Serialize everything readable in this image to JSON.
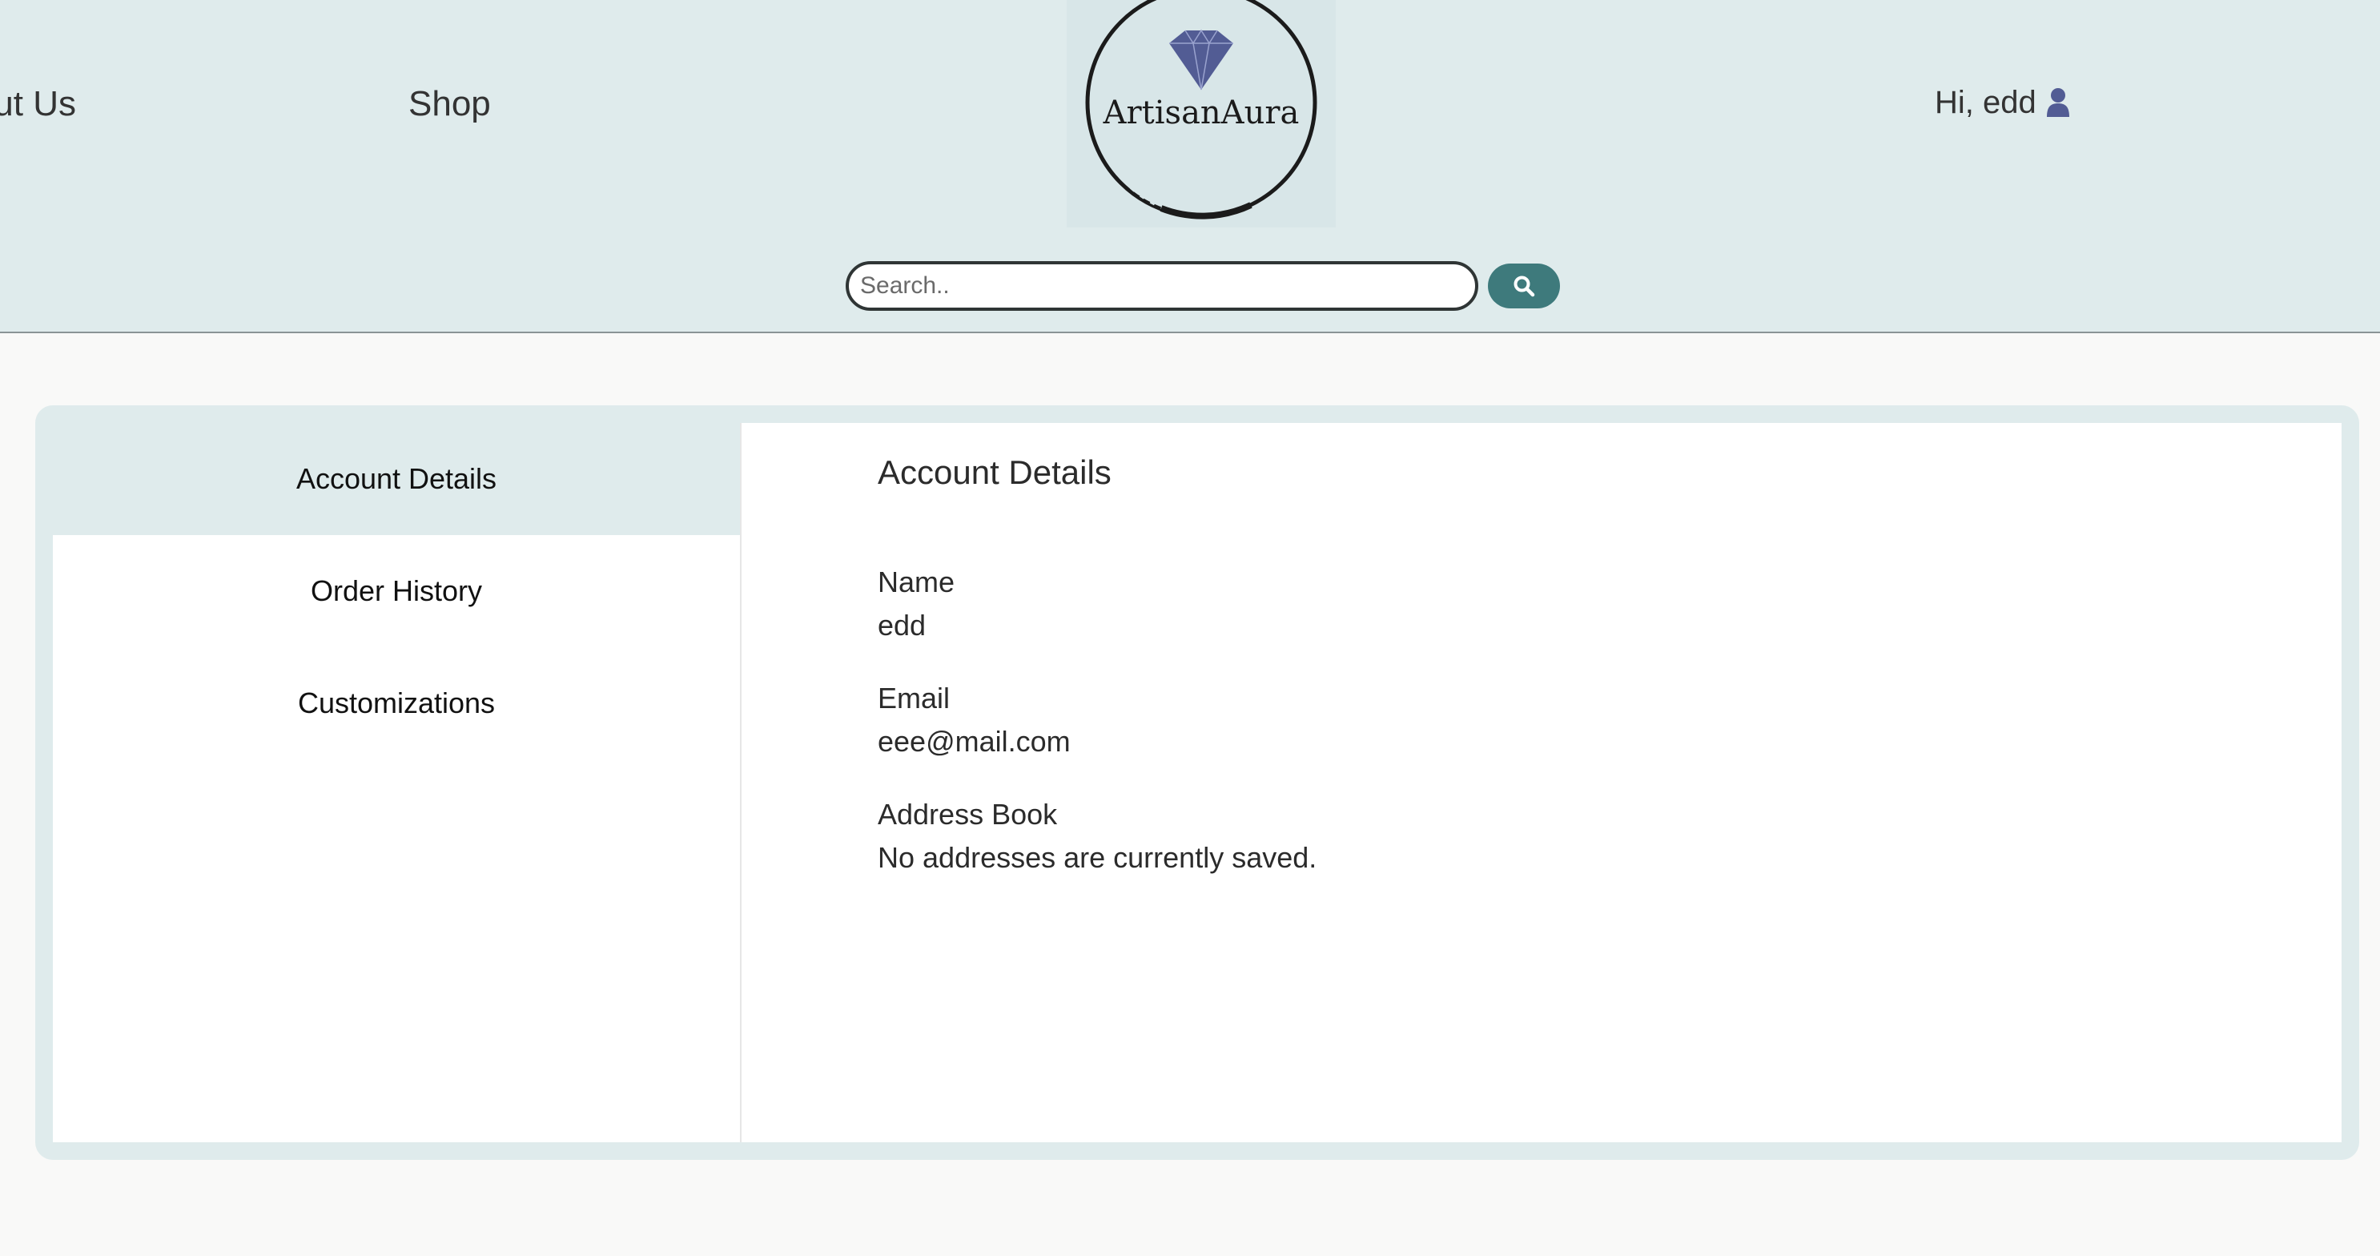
{
  "nav": {
    "about_label": "About Us",
    "shop_label": "Shop"
  },
  "logo": {
    "text": "ArtisanAura",
    "icon": "diamond-icon"
  },
  "user": {
    "greeting": "Hi, edd",
    "icon": "user-icon"
  },
  "search": {
    "placeholder": "Search..",
    "value": "",
    "button_icon": "search-icon"
  },
  "sidebar": {
    "items": [
      {
        "label": "Account Details",
        "active": true
      },
      {
        "label": "Order History",
        "active": false
      },
      {
        "label": "Customizations",
        "active": false
      }
    ]
  },
  "account": {
    "title": "Account Details",
    "name_label": "Name",
    "name_value": "edd",
    "email_label": "Email",
    "email_value": "eee@mail.com",
    "address_label": "Address Book",
    "address_value": "No addresses are currently saved."
  },
  "colors": {
    "header_bg": "#dfebec",
    "accent": "#3e7a7c",
    "brand_icon": "#515b94",
    "page_bg": "#f9f9f8"
  }
}
